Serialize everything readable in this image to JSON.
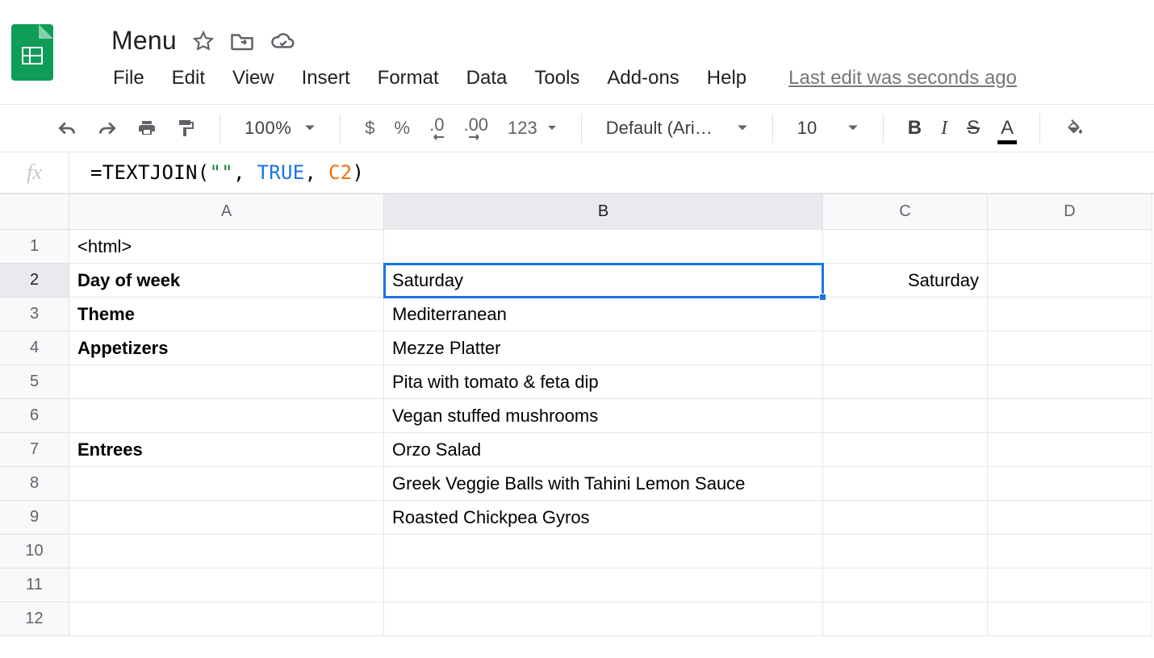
{
  "doc": {
    "title": "Menu"
  },
  "menus": {
    "file": "File",
    "edit": "Edit",
    "view": "View",
    "insert": "Insert",
    "format": "Format",
    "data": "Data",
    "tools": "Tools",
    "addons": "Add-ons",
    "help": "Help",
    "last_edit": "Last edit was seconds ago"
  },
  "toolbar": {
    "zoom": "100%",
    "currency": "$",
    "percent": "%",
    "dec_less": ".0",
    "dec_more": ".00",
    "format_more": "123",
    "font": "Default (Ari…",
    "font_size": "10",
    "bold": "B",
    "italic": "I",
    "strike": "S",
    "textcolor": "A"
  },
  "formula": {
    "fn": "=TEXTJOIN",
    "arg1_str": "\"\"",
    "arg2_bool": "TRUE",
    "arg3_ref": "C2"
  },
  "columns": {
    "A": "A",
    "B": "B",
    "C": "C",
    "D": "D"
  },
  "rows": [
    "1",
    "2",
    "3",
    "4",
    "5",
    "6",
    "7",
    "8",
    "9",
    "10",
    "11",
    "12"
  ],
  "selected_cell": "B2",
  "cells": {
    "A1": "<html>",
    "A2": "Day of week",
    "A3": "Theme",
    "A4": "Appetizers",
    "A7": "Entrees",
    "B2": "Saturday",
    "B3": "Mediterranean",
    "B4": "Mezze Platter",
    "B5": "Pita with tomato & feta dip",
    "B6": "Vegan stuffed mushrooms",
    "B7": "Orzo Salad",
    "B8": "Greek Veggie Balls with Tahini Lemon Sauce",
    "B9": "Roasted Chickpea Gyros",
    "C2": "Saturday"
  }
}
